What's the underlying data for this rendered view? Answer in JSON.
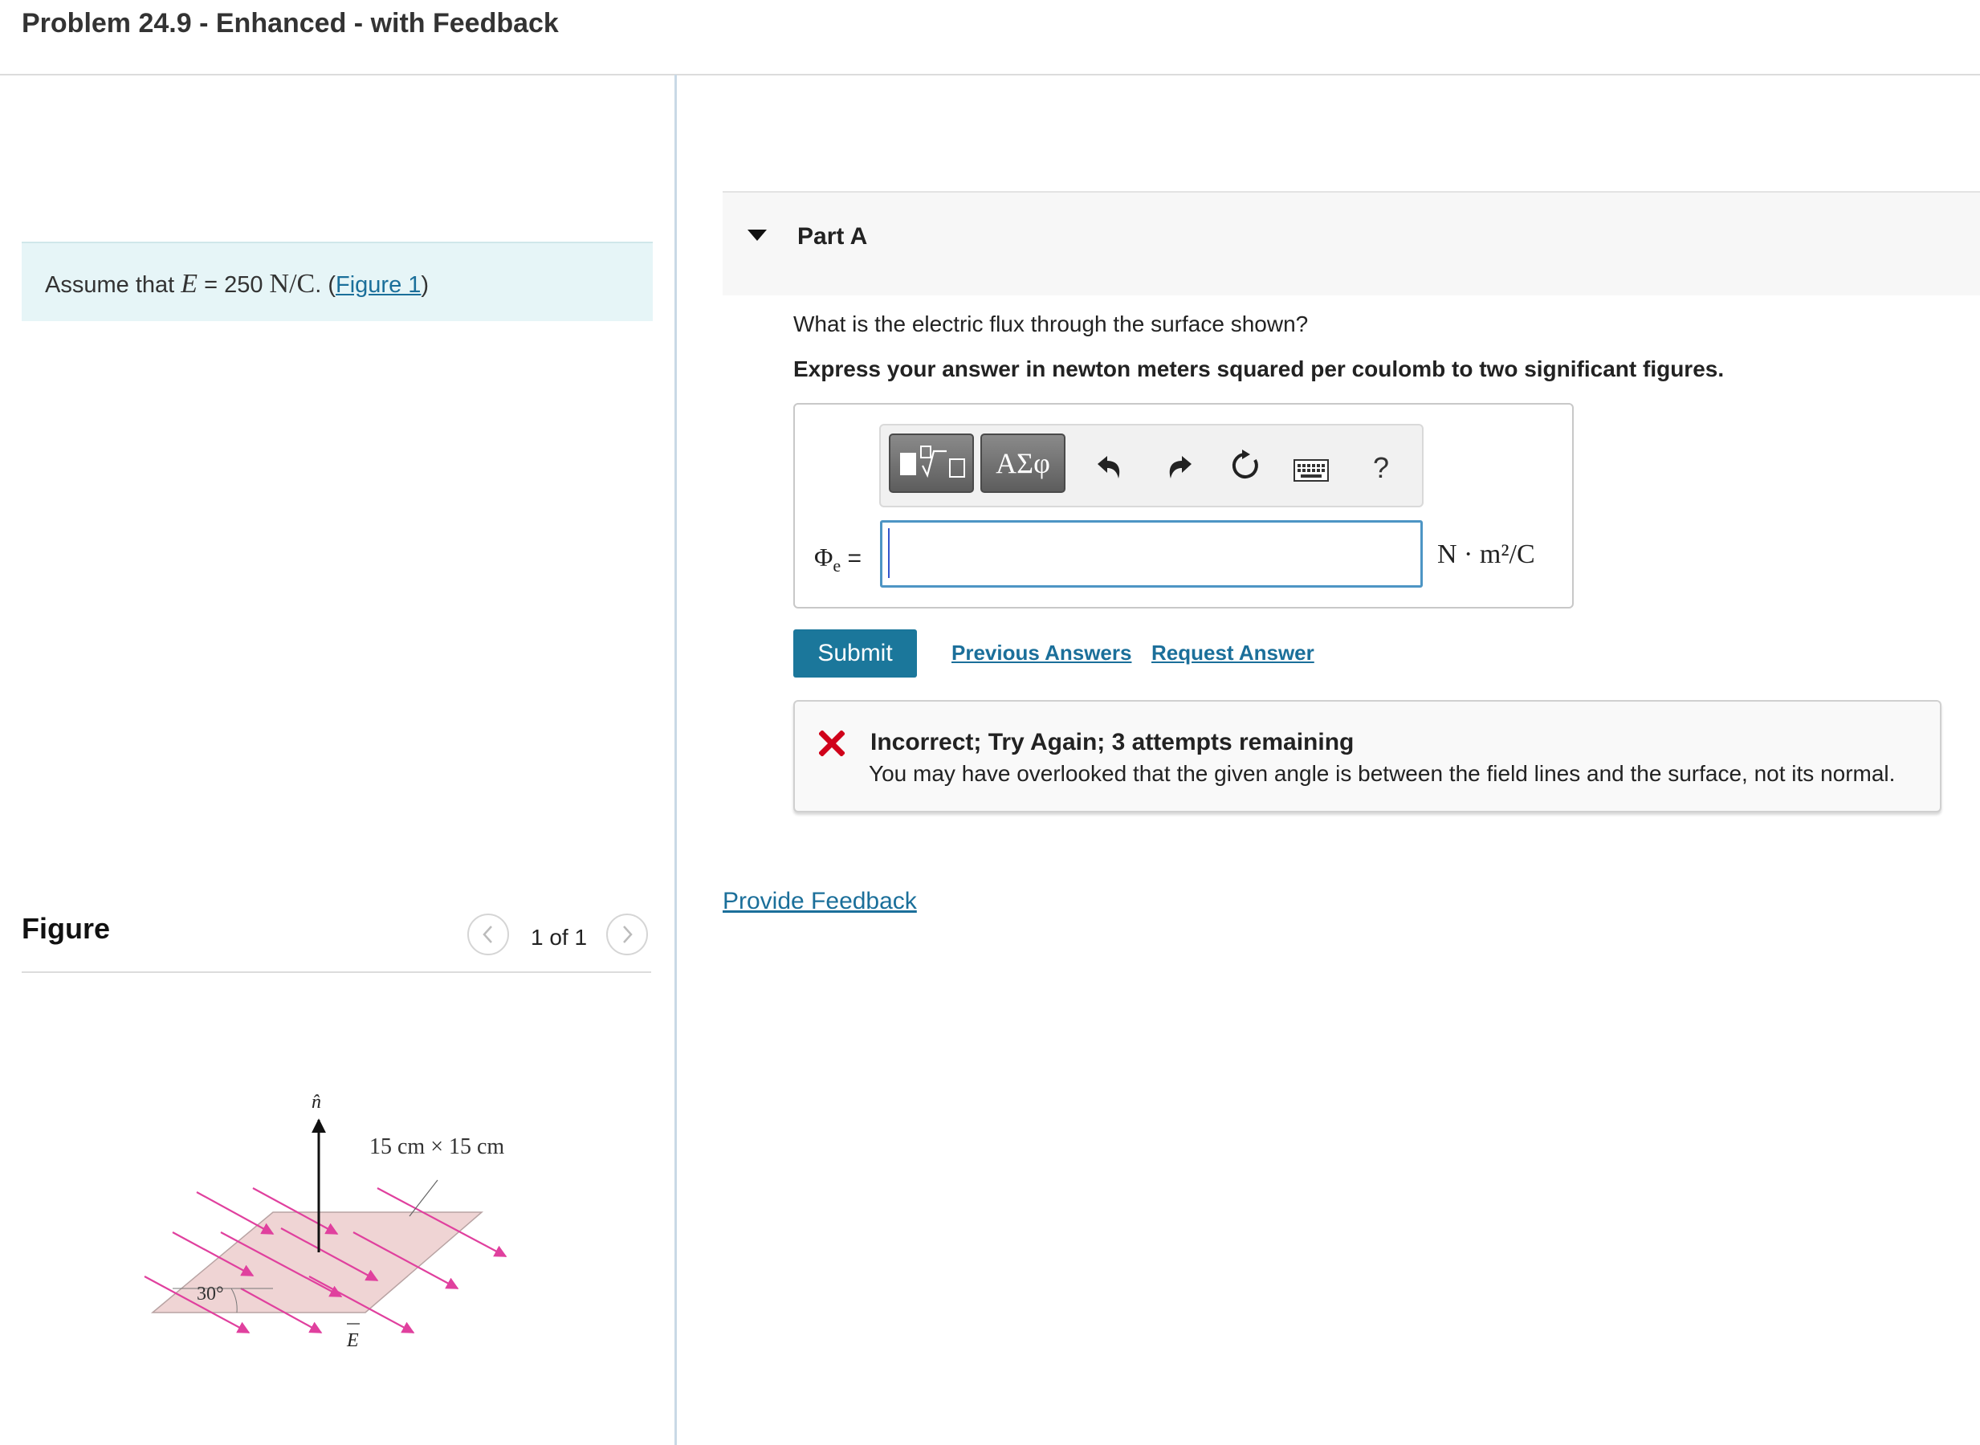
{
  "header": {
    "title": "Problem 24.9 - Enhanced - with Feedback"
  },
  "intro": {
    "assume_text": "Assume that",
    "variable": "E",
    "equals_value": "= 250",
    "unit": "N/C",
    "period": ". (",
    "figure_link": "Figure 1",
    "close_paren": ")"
  },
  "figure_panel": {
    "title": "Figure",
    "counter": "1 of 1",
    "labels": {
      "normal": "n̂",
      "size": "15 cm × 15 cm",
      "angle": "30°",
      "field": "E"
    }
  },
  "part": {
    "title": "Part A",
    "question": "What is the electric flux through the surface shown?",
    "instruction": "Express your answer in newton meters squared per coulomb to two significant figures.",
    "toolbar": {
      "greek_label": "ΑΣφ",
      "help_label": "?"
    },
    "answer": {
      "symbol": "Φ",
      "subscript": "e",
      "equals": "=",
      "value": "",
      "units": "N · m²/C"
    },
    "submit_label": "Submit",
    "previous_answers_label": "Previous Answers",
    "request_answer_label": "Request Answer"
  },
  "feedback": {
    "title": "Incorrect; Try Again; 3 attempts remaining",
    "message": "You may have overlooked that the given angle is between the field lines and the surface, not its normal.",
    "status_color": "#d0021b"
  },
  "footer": {
    "provide_feedback_label": "Provide Feedback"
  },
  "colors": {
    "accent": "#1b779b",
    "link": "#1b6f9a",
    "intro_bg": "#e6f5f7",
    "field_arrows": "#e0409e"
  }
}
